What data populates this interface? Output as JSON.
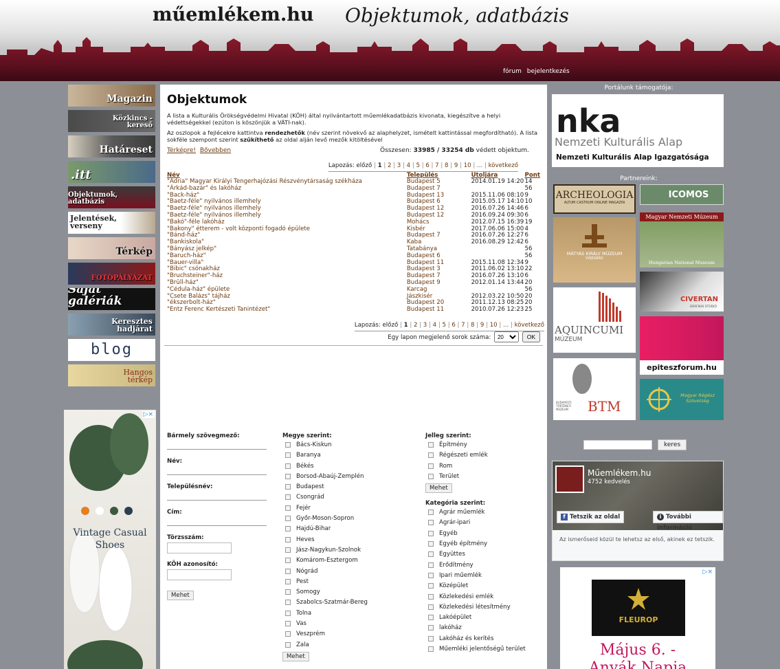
{
  "header": {
    "site_name": "műemlékem.hu",
    "subtitle": "Objektumok, adatbázis",
    "links": [
      "fórum",
      "bejelentkezés"
    ]
  },
  "left_nav": [
    {
      "label": "Magazin",
      "name": "nav-magazin"
    },
    {
      "label": "Közkincs -kereső",
      "name": "nav-kozkincs"
    },
    {
      "label": "Határeset",
      "name": "nav-hatareset"
    },
    {
      "label": ".itt",
      "name": "nav-itt"
    },
    {
      "label": "Objektumok, adatbázis",
      "name": "nav-objektumok"
    },
    {
      "label": "Jelentések, verseny",
      "name": "nav-jelentesek"
    },
    {
      "label": "Térkép",
      "name": "nav-terkep"
    },
    {
      "label": "FOTÓPÁLYÁZAT",
      "name": "nav-fotopalyazat"
    },
    {
      "label": "Saját galériák",
      "name": "nav-galeriak"
    },
    {
      "label": "Keresztes hadjárat",
      "name": "nav-keresztes"
    },
    {
      "label": "blog",
      "name": "nav-blog"
    },
    {
      "label": "Hangos térkép",
      "name": "nav-hangos"
    }
  ],
  "left_ad": {
    "text1": "Vintage Casual",
    "text2": "Shoes",
    "flag": "▷×"
  },
  "main": {
    "title": "Objektumok",
    "intro1": "A lista a Kulturális Örökségvédelmi Hivatal (KÖH) által nyilvántartott műemlékadatbázis kivonata, kiegészítve a helyi védettségekkel (ezúton is köszönjük a VÁTI-nak).",
    "intro2_a": "Az oszlopok a fejlécekre kattintva ",
    "intro2_b": "rendezhetők",
    "intro2_c": " (név szerint növekvő az alaphelyzet, ismételt kattintással megfordítható). A lista sokféle szempont szerint ",
    "intro2_d": "szűkíthető",
    "intro2_e": " az oldal alján levő mezők kitöltésével",
    "link_map": "Térképre!",
    "link_more": "Bővebben",
    "total_prefix": "Összesen: ",
    "total_value": "33985 / 33254 db",
    "total_suffix": " védett objektum.",
    "pager": {
      "prefix": "Lapozás: előző",
      "pages": [
        "1",
        "2",
        "3",
        "4",
        "5",
        "6",
        "7",
        "8",
        "9",
        "10",
        "..."
      ],
      "next": "következő"
    },
    "columns": [
      "Név",
      "Település",
      "Utoljára",
      "Pont"
    ],
    "rows": [
      [
        "\"Adria\" Magyar Királyi Tengerhajózási Részvénytársaság székháza",
        "Budapest 5",
        "2014.01.19 14:20",
        "14"
      ],
      [
        "\"Árkád-bazár\" és lakóház",
        "Budapest 7",
        "",
        "56"
      ],
      [
        "\"Back-ház\"",
        "Budapest 13",
        "2015.11.06 08:10",
        "9"
      ],
      [
        "\"Baetz-féle\" nyilvános illemhely",
        "Budapest 6",
        "2015.05.17 14:10",
        "10"
      ],
      [
        "\"Baetz-féle\" nyilvános illemhely",
        "Budapest 12",
        "2016.07.26 14:46",
        "6"
      ],
      [
        "\"Baetz-féle\" nyilvános illemhely",
        "Budapest 12",
        "2016.09.24 09:30",
        "6"
      ],
      [
        "\"Bakó\"-féle lakóház",
        "Mohács",
        "2012.07.15 16:39",
        "19"
      ],
      [
        "\"Bakony\" étterem - volt központi fogadó épülete",
        "Kisbér",
        "2017.06.06 15:00",
        "4"
      ],
      [
        "\"Bánd-ház\"",
        "Budapest 7",
        "2016.07.26 12:27",
        "6"
      ],
      [
        "\"Bankiskola\"",
        "Kaba",
        "2016.08.29 12:42",
        "6"
      ],
      [
        "\"Bányász jelkép\"",
        "Tatabánya",
        "",
        "56"
      ],
      [
        "\"Baruch-ház\"",
        "Budapest 6",
        "",
        "56"
      ],
      [
        "\"Bauer-villa\"",
        "Budapest 11",
        "2015.11.08 12:34",
        "9"
      ],
      [
        "\"Bibic\" csónakház",
        "Budapest 3",
        "2011.06.02 13:10",
        "22"
      ],
      [
        "\"Bruchsteiner\"-ház",
        "Budapest 7",
        "2016.07.26 13:10",
        "6"
      ],
      [
        "\"Brüll-ház\"",
        "Budapest 9",
        "2012.01.14 13:44",
        "20"
      ],
      [
        "\"Cédula-ház\" épülete",
        "Karcag",
        "",
        "56"
      ],
      [
        "\"Csete Balázs\" tájház",
        "Jászkisér",
        "2012.03.22 10:50",
        "20"
      ],
      [
        "\"ékszerbolt-ház\"",
        "Budapest 20",
        "2011.12.13 08:25",
        "20"
      ],
      [
        "\"Entz Ferenc Kertészeti Tanintézet\"",
        "Budapest 11",
        "2010.07.26 12:23",
        "25"
      ]
    ],
    "perpage_label": "Egy lapon megjelenő sorok száma:",
    "perpage_value": "20",
    "ok_label": "OK"
  },
  "filters": {
    "text_title": "Bármely szövegmező:",
    "fields": [
      "Név:",
      "Településnév:",
      "Cím:",
      "Törzsszám:",
      "KÖH azonosító:"
    ],
    "go_label": "Mehet",
    "megye_title": "Megye szerint:",
    "megye": [
      "Bács-Kiskun",
      "Baranya",
      "Békés",
      "Borsod-Abaúj-Zemplén",
      "Budapest",
      "Csongrád",
      "Fejér",
      "Győr-Moson-Sopron",
      "Hajdú-Bihar",
      "Heves",
      "Jász-Nagykun-Szolnok",
      "Komárom-Esztergom",
      "Nógrád",
      "Pest",
      "Somogy",
      "Szabolcs-Szatmár-Bereg",
      "Tolna",
      "Vas",
      "Veszprém",
      "Zala"
    ],
    "jelleg_title": "Jelleg szerint:",
    "jelleg": [
      "Építmény",
      "Régészeti emlék",
      "Rom",
      "Terület"
    ],
    "kategoria_title": "Kategória szerint:",
    "kategoria": [
      "Agrár műemlék",
      "Agrár-ipari",
      "Egyéb",
      "Egyéb építmény",
      "Együttes",
      "Erődítmény",
      "Ipari műemlék",
      "Középület",
      "Közlekedési emlék",
      "Közlekedési létesítmény",
      "Lakóépület",
      "lakóház",
      "Lakóház és kerítés",
      "Műemléki jelentőségű terület"
    ]
  },
  "right": {
    "sponsor_label": "Portálunk támogatója:",
    "nka_logo": "nka",
    "nka_name": "Nemzeti Kulturális Alap",
    "nka_org": "Nemzeti Kulturális Alap Igazgatósága",
    "partners_label": "Partnereink:",
    "partners": {
      "archeologia": "ARCHEOLOGIA",
      "archeologia_sub": "ALTUM CASTRUM ONLINE MAGAZIN",
      "icomos": "ICOMOS",
      "mnm": "Magyar Nemzeti Múzeum",
      "mnm_en": "Hungarian National Museum",
      "matyas": "MÁTYÁS KIRÁLY MÚZEUM",
      "matyas_sub": "VISEGRÁD",
      "civertan": "CIVERTAN",
      "civertan_sub": "GRAFIKAI STÚDIÓ",
      "aquincum": "AQUINCUMI",
      "aquincum_sub": "MÚZEUM",
      "epiteszforum": "epiteszforum.hu",
      "btm": "BTM",
      "btm_sub": "BUDAPESTI TÖRTÉNETI MÚZEUM",
      "regesz": "Magyar Régész Szövetség"
    },
    "search_button": "keres",
    "fb": {
      "page_name": "Műemlékem.hu",
      "likes": "4752 kedvelés",
      "like_btn": "Tetszik az oldal",
      "info_btn": "További információ",
      "text": "Az ismerőseid közül te lehetsz az első, akinek ez tetszik."
    },
    "ad": {
      "brand": "FLEUROP",
      "date": "Május 6. -",
      "event": "Anyák Napja",
      "flag": "▷×"
    }
  }
}
